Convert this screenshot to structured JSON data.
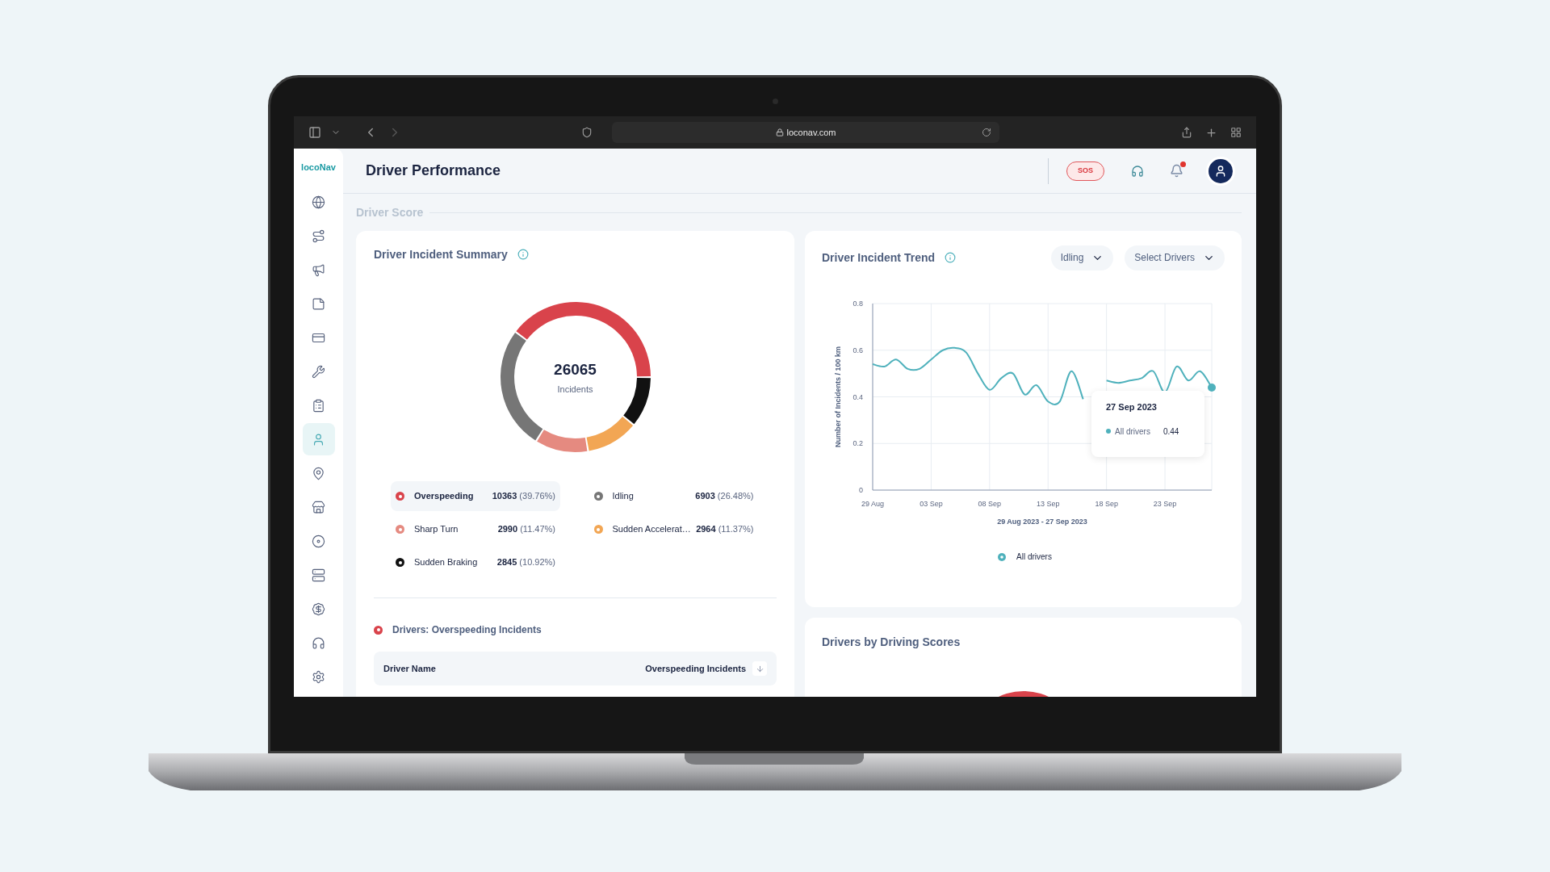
{
  "browser": {
    "url": "loconav.com"
  },
  "sidebar": {
    "logo": "locoNav",
    "items": [
      {
        "selected": false
      },
      {
        "selected": false
      },
      {
        "selected": false
      },
      {
        "selected": false
      },
      {
        "selected": false
      },
      {
        "selected": false
      },
      {
        "selected": false
      },
      {
        "selected": true
      },
      {
        "selected": false
      },
      {
        "selected": false
      },
      {
        "selected": false
      },
      {
        "selected": false
      },
      {
        "selected": false
      },
      {
        "selected": false
      },
      {
        "selected": false
      }
    ]
  },
  "header": {
    "title": "Driver Performance",
    "sos": "SOS",
    "notifications": {
      "unread": true
    }
  },
  "section_title": "Driver Score",
  "incident_summary": {
    "title": "Driver Incident Summary",
    "total": "26065",
    "total_label": "Incidents",
    "legend": [
      {
        "name": "Overspeeding",
        "count": "10363",
        "percent": "(39.76%)",
        "color": "#d9434b",
        "selected": true
      },
      {
        "name": "Idling",
        "count": "6903",
        "percent": "(26.48%)",
        "color": "#767676",
        "selected": false
      },
      {
        "name": "Sharp Turn",
        "count": "2990",
        "percent": "(11.47%)",
        "color": "#e58a80",
        "selected": false
      },
      {
        "name": "Sudden Accelerat…",
        "count": "2964",
        "percent": "(11.37%)",
        "color": "#f2a654",
        "selected": false
      },
      {
        "name": "Sudden Braking",
        "count": "2845",
        "percent": "(10.92%)",
        "color": "#111111",
        "selected": false
      }
    ],
    "chart_data": {
      "type": "donut",
      "values": [
        39.76,
        26.48,
        11.47,
        11.37,
        10.92
      ]
    },
    "drivers_title": "Drivers: Overspeeding Incidents",
    "table": {
      "columns": [
        "Driver Name",
        "Overspeeding Incidents"
      ]
    }
  },
  "incident_trend": {
    "title": "Driver Incident Trend",
    "filters": [
      "Idling",
      "Select Drivers"
    ],
    "chart_data": {
      "type": "line",
      "xlabel": "29 Aug 2023 - 27 Sep 2023",
      "ylabel": "Number of Incidents / 100 km",
      "categories": [
        "29 Aug",
        null,
        null,
        null,
        null,
        "03 Sep",
        null,
        null,
        null,
        null,
        "08 Sep",
        null,
        null,
        null,
        null,
        "13 Sep",
        null,
        null,
        null,
        null,
        "18 Sep",
        null,
        null,
        null,
        null,
        "23 Sep",
        null,
        null,
        null,
        null
      ],
      "ylim": [
        0,
        0.8
      ],
      "grid": true,
      "yticks": [
        0,
        0.2,
        0.4,
        0.6,
        0.8
      ],
      "series": [
        {
          "name": "All drivers",
          "color": "#4fb1bc",
          "values": [
            0.54,
            0.53,
            0.56,
            0.52,
            0.52,
            0.56,
            0.6,
            0.61,
            0.59,
            0.5,
            0.43,
            0.48,
            0.5,
            0.41,
            0.45,
            0.38,
            0.38,
            0.51,
            0.39,
            null,
            0.47,
            0.46,
            0.47,
            0.48,
            0.51,
            0.42,
            0.53,
            0.47,
            0.51,
            0.44
          ]
        }
      ]
    },
    "tooltip": {
      "title": "27 Sep 2023",
      "label": "All drivers",
      "value": "0.44"
    }
  },
  "scores_card": {
    "title": "Drivers by Driving Scores"
  }
}
